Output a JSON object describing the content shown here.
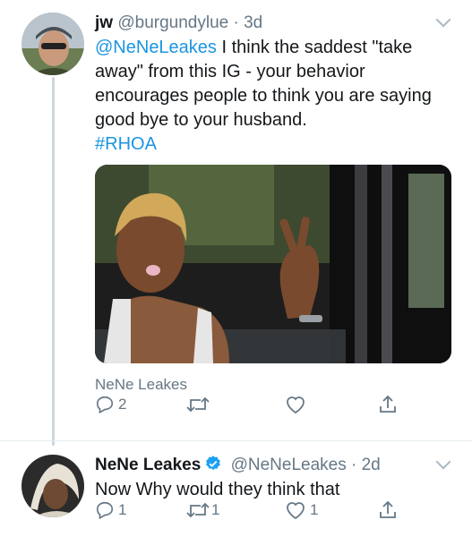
{
  "tweet1": {
    "name": "jw",
    "handle": "@burgundylue",
    "sep": "·",
    "time": "3d",
    "mention": "@NeNeLeakes",
    "text_rest": " I think the saddest \"take away\" from this IG - your behavior encourages people to think you are saying good bye to your husband.",
    "hashtag": "#RHOA",
    "media_caption": "NeNe Leakes",
    "replies": "2",
    "retweets": "",
    "likes": ""
  },
  "tweet2": {
    "name": "NeNe Leakes",
    "handle": "@NeNeLeakes",
    "sep": "·",
    "time": "2d",
    "text": "Now Why would they think that",
    "replies": "1",
    "retweets": "1",
    "likes": "1"
  },
  "colors": {
    "link": "#1b95e0",
    "muted": "#657786",
    "verified": "#1da1f2",
    "thread_line": "#ccd6dd"
  },
  "icons": [
    "reply-icon",
    "retweet-icon",
    "like-icon",
    "share-icon",
    "verified-badge-icon",
    "chevron-down-icon"
  ]
}
